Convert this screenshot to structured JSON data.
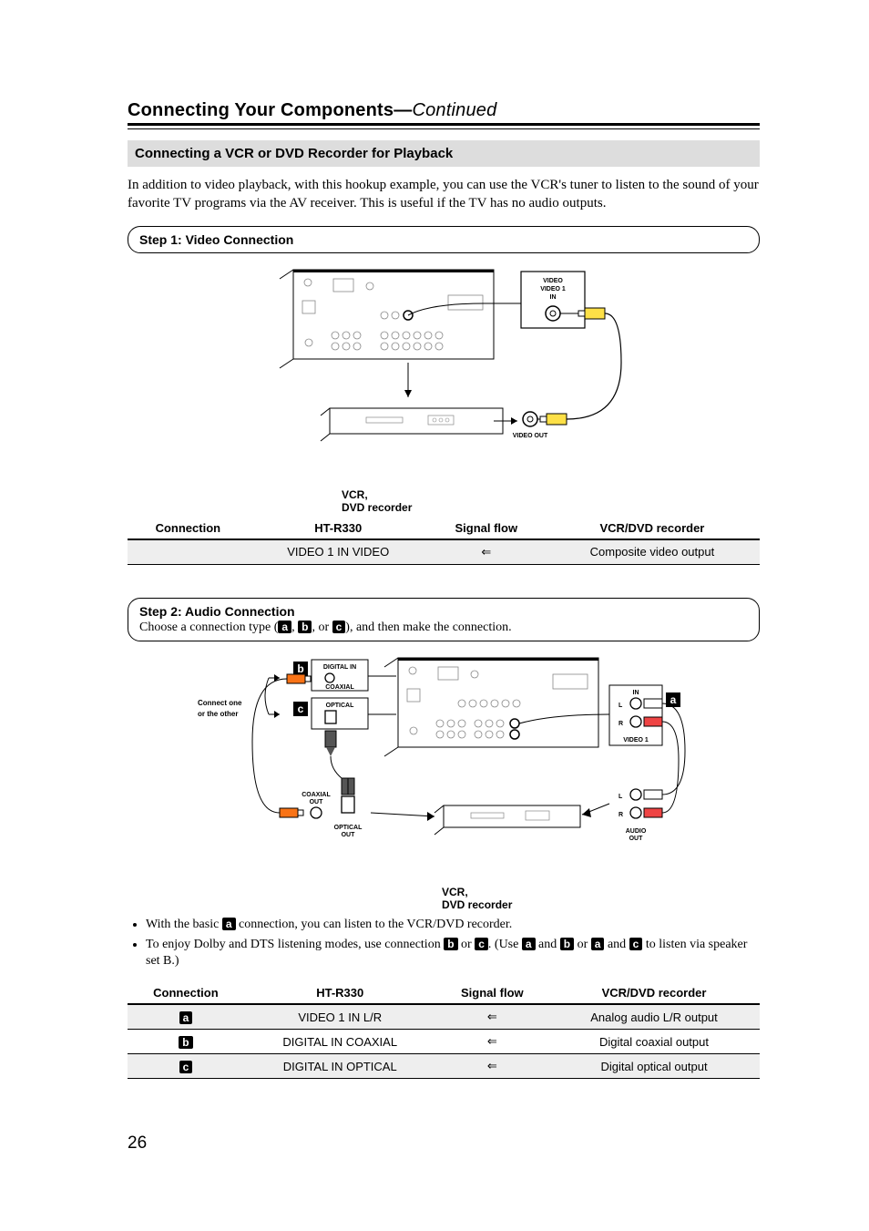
{
  "heading": {
    "main": "Connecting Your Components",
    "sep": "—",
    "cont": "Continued"
  },
  "section": "Connecting a VCR or DVD Recorder for Playback",
  "intro": "In addition to video playback, with this hookup example, you can use the VCR's tuner to listen to the sound of your favorite TV programs via the AV receiver. This is useful if the TV has no audio outputs.",
  "step1": {
    "title": "Step 1: Video Connection",
    "device_caption": "VCR,\nDVD recorder",
    "port_label": "VIDEO OUT",
    "jack_group": {
      "l1": "VIDEO",
      "l2": "VIDEO 1",
      "l3": "IN"
    },
    "table": {
      "headers": [
        "Connection",
        "HT-R330",
        "Signal flow",
        "VCR/DVD recorder"
      ],
      "row": {
        "c": "",
        "r": "VIDEO 1 IN VIDEO",
        "f": "⇐",
        "d": "Composite video output"
      }
    }
  },
  "step2": {
    "title": "Step 2: Audio Connection",
    "choose_pre": "Choose a connection type (",
    "choose_mid1": ", ",
    "choose_mid2": ", or ",
    "choose_post": "), and then make the connection.",
    "markers": {
      "a": "a",
      "b": "b",
      "c": "c"
    },
    "side_text": "Connect one\nor the other",
    "labels": {
      "digital_in": "DIGITAL IN",
      "coaxial": "COAXIAL",
      "optical": "OPTICAL",
      "coaxial_out": "COAXIAL\nOUT",
      "optical_out": "OPTICAL\nOUT",
      "in": "IN",
      "L": "L",
      "R": "R",
      "video1": "VIDEO 1",
      "audio_out": "AUDIO\nOUT"
    },
    "device_caption": "VCR,\nDVD recorder",
    "notes": [
      {
        "pre": "With the basic ",
        "m": "a",
        "post": " connection, you can listen to the VCR/DVD recorder."
      },
      {
        "text_parts": [
          "To enjoy Dolby and DTS listening modes, use connection ",
          "b",
          " or ",
          "c",
          ". (Use ",
          "a",
          " and ",
          "b",
          " or ",
          "a",
          " and ",
          "c",
          " to listen via speaker set B.)"
        ]
      }
    ],
    "table": {
      "headers": [
        "Connection",
        "HT-R330",
        "Signal flow",
        "VCR/DVD recorder"
      ],
      "rows": [
        {
          "c": "a",
          "r": "VIDEO 1 IN L/R",
          "f": "⇐",
          "d": "Analog audio L/R output",
          "shade": true
        },
        {
          "c": "b",
          "r": "DIGITAL IN COAXIAL",
          "f": "⇐",
          "d": "Digital coaxial output",
          "shade": false
        },
        {
          "c": "c",
          "r": "DIGITAL IN OPTICAL",
          "f": "⇐",
          "d": "Digital optical output",
          "shade": true
        }
      ]
    }
  },
  "page_number": "26"
}
